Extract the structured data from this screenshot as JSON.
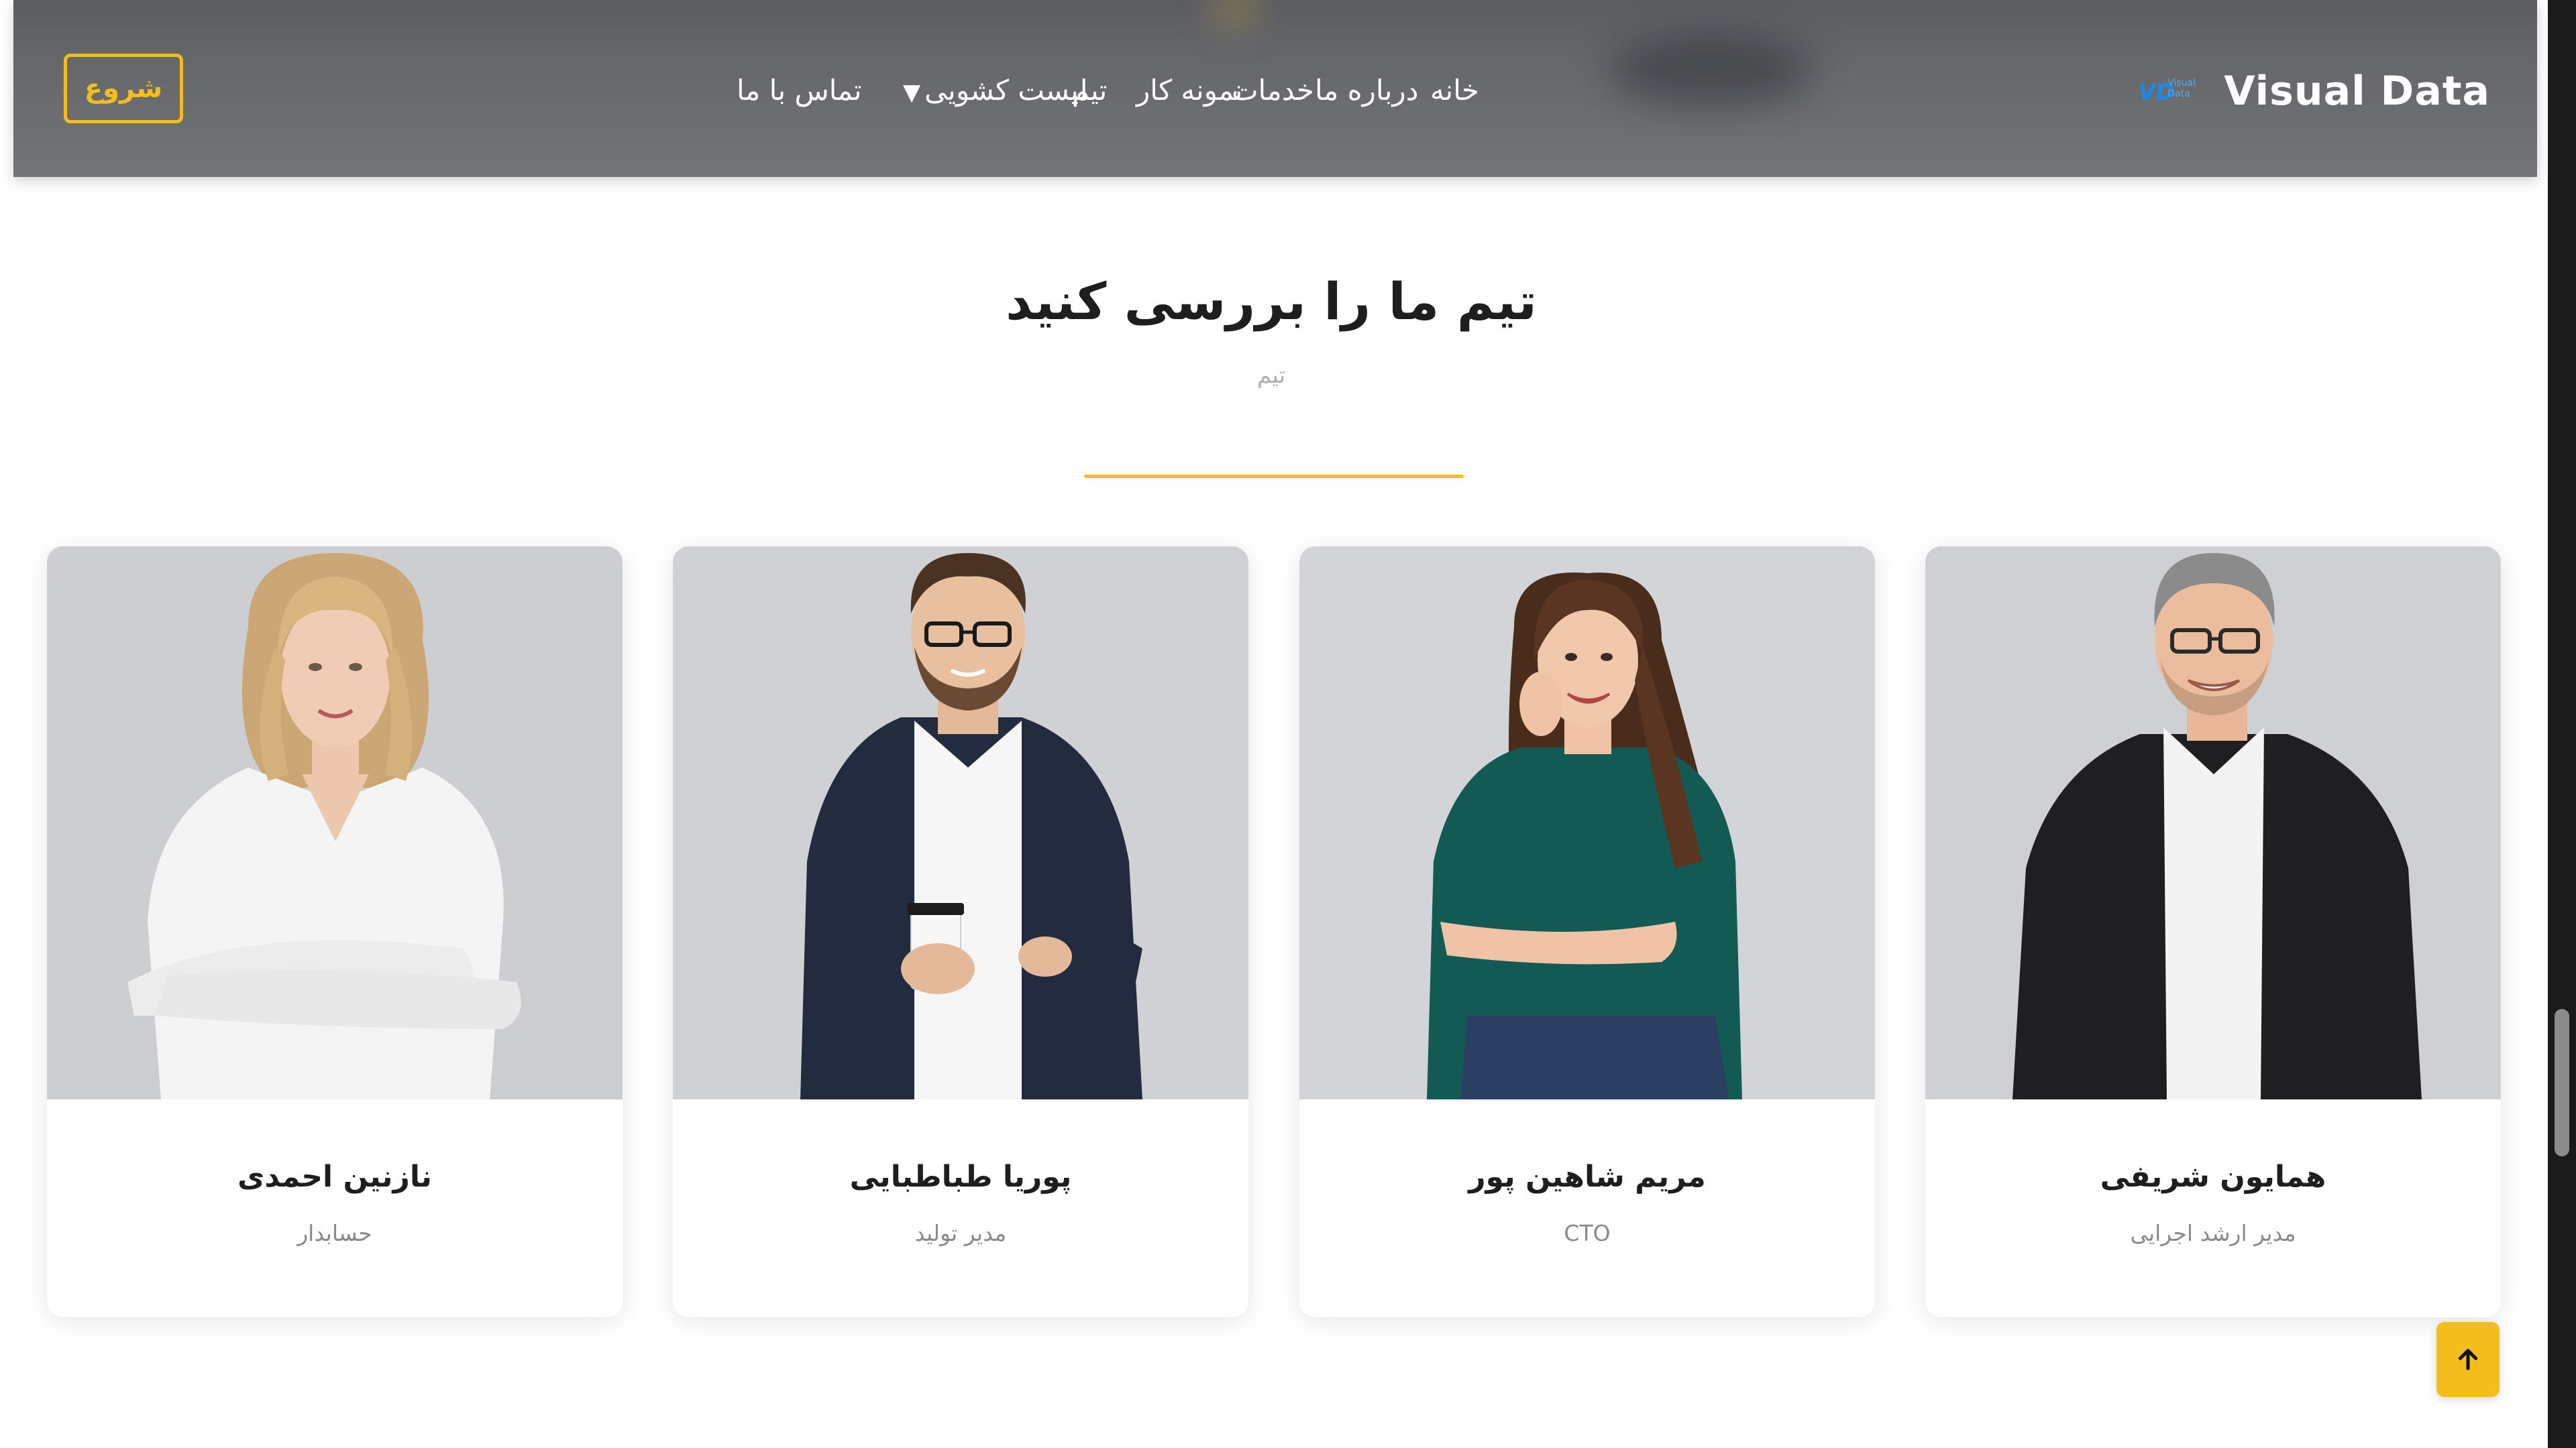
{
  "header": {
    "brand": "Visual Data",
    "logo_mark": "VD",
    "logo_text_1": "Visual",
    "logo_text_2": "Data",
    "nav": [
      {
        "label": "خانه"
      },
      {
        "label": "درباره ما"
      },
      {
        "label": "خدمات"
      },
      {
        "label": "نمونه کار"
      },
      {
        "label": "تیم"
      },
      {
        "label": "لیست کشویی",
        "caret": "▼"
      },
      {
        "label": "تماس با ما"
      }
    ],
    "cta": "شروع"
  },
  "section": {
    "title": "تیم ما را بررسی کنید",
    "subtitle": "تیم",
    "accent": "#f3bd1c"
  },
  "team": [
    {
      "name": "نازنین احمدی",
      "role": "حسابدار"
    },
    {
      "name": "پوریا طباطبایی",
      "role": "مدیر تولید"
    },
    {
      "name": "مریم شاهین پور",
      "role": "CTO"
    },
    {
      "name": "همایون شریفی",
      "role": "مدیر ارشد اجرایی"
    }
  ],
  "icons": {
    "back_to_top": "arrow-up-icon",
    "dropdown": "caret-down-icon"
  }
}
